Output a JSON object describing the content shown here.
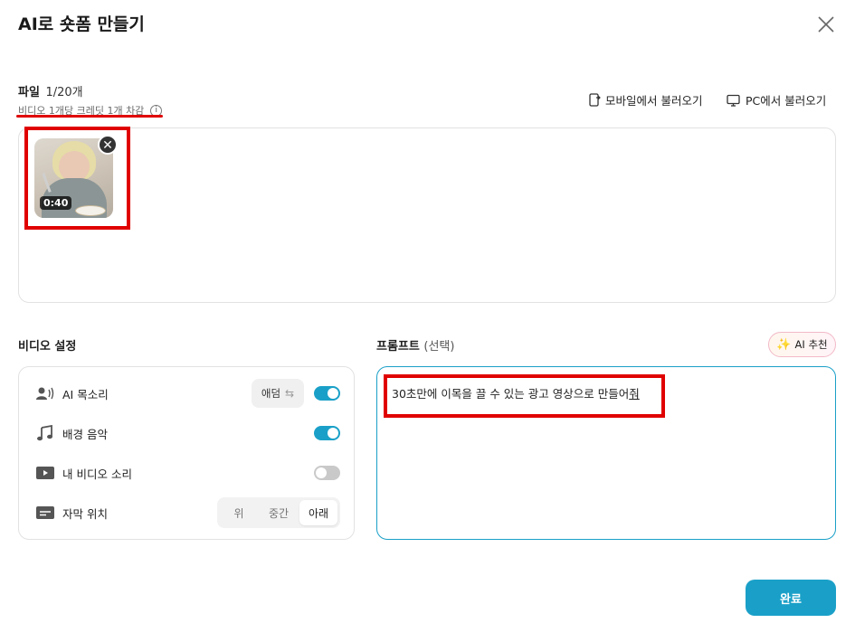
{
  "dialog": {
    "title": "AI로 숏폼 만들기"
  },
  "files": {
    "label": "파일",
    "count": "1/20개",
    "credit_note": "비디오 1개당 크레딧 1개 차감",
    "import_mobile": "모바일에서 불러오기",
    "import_pc": "PC에서 불러오기",
    "items": [
      {
        "duration": "0:40"
      }
    ]
  },
  "video_settings": {
    "title": "비디오 설정",
    "rows": [
      {
        "label": "AI 목소리",
        "icon": "voice-user-icon",
        "chip": "애덤",
        "toggle": true
      },
      {
        "label": "배경 음악",
        "icon": "music-note-icon",
        "toggle": true
      },
      {
        "label": "내 비디오 소리",
        "icon": "play-icon",
        "toggle": false
      },
      {
        "label": "자막 위치",
        "icon": "subtitle-icon",
        "options": [
          "위",
          "중간",
          "아래"
        ],
        "selected": "아래"
      }
    ]
  },
  "prompt": {
    "title": "프롬프트",
    "optional": "(선택)",
    "ai_recommend": "AI 추천",
    "text_main": "30초만에 이목을 끌 수 있는 광고 영상으로 만들어",
    "text_tail": "줘"
  },
  "footer": {
    "done_label": "완료"
  },
  "colors": {
    "accent": "#1aa0c8",
    "highlight": "#e00000"
  }
}
